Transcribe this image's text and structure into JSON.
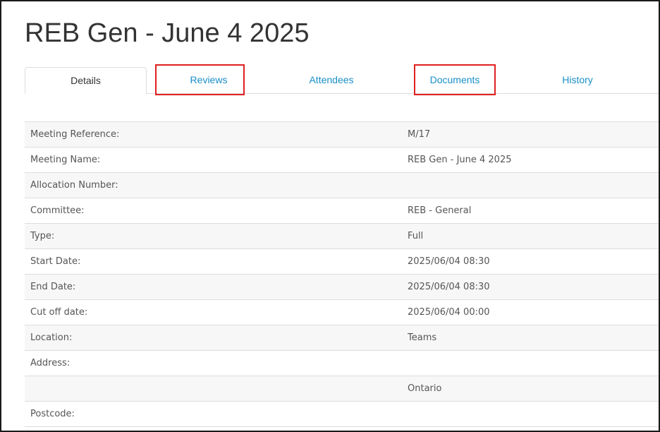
{
  "page": {
    "title": "REB Gen - June 4 2025"
  },
  "tabs": [
    {
      "label": "Details",
      "active": true
    },
    {
      "label": "Reviews",
      "active": false,
      "highlighted": true
    },
    {
      "label": "Attendees",
      "active": false
    },
    {
      "label": "Documents",
      "active": false,
      "highlighted": true
    },
    {
      "label": "History",
      "active": false
    }
  ],
  "details": {
    "rows": [
      {
        "label": "Meeting Reference:",
        "value": "M/17"
      },
      {
        "label": "Meeting Name:",
        "value": "REB Gen - June 4 2025"
      },
      {
        "label": "Allocation Number:",
        "value": ""
      },
      {
        "label": "Committee:",
        "value": "REB - General"
      },
      {
        "label": "Type:",
        "value": "Full"
      },
      {
        "label": "Start Date:",
        "value": "2025/06/04 08:30"
      },
      {
        "label": "End Date:",
        "value": "2025/06/04 08:30"
      },
      {
        "label": "Cut off date:",
        "value": "2025/06/04 00:00"
      },
      {
        "label": "Location:",
        "value": "Teams"
      },
      {
        "label": "Address:",
        "value": ""
      },
      {
        "label": "",
        "value": "Ontario"
      },
      {
        "label": "Postcode:",
        "value": ""
      }
    ]
  },
  "colors": {
    "tab_link": "#1a8fc8",
    "highlight": "#e02020",
    "row_stripe": "#f7f7f7",
    "border": "#dddddd"
  }
}
